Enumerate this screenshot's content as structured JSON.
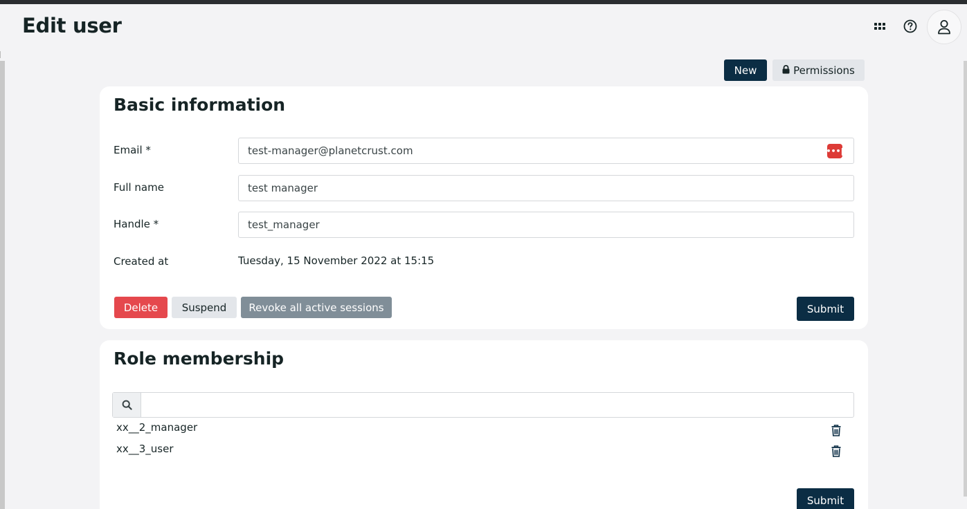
{
  "header": {
    "title": "Edit user",
    "icons": [
      "apps-grid-icon",
      "help-circle-icon",
      "user-avatar-icon"
    ]
  },
  "toolbar": {
    "new_label": "New",
    "permissions_label": "Permissions"
  },
  "basic_info": {
    "title": "Basic information",
    "fields": {
      "email": {
        "label": "Email *",
        "value": "test-manager@planetcrust.com"
      },
      "full_name": {
        "label": "Full name",
        "value": "test manager"
      },
      "handle": {
        "label": "Handle *",
        "value": "test_manager"
      },
      "created_at": {
        "label": "Created at",
        "value": "Tuesday, 15 November 2022 at 15:15"
      }
    },
    "password_manager_badge": "•••|",
    "buttons": {
      "delete": "Delete",
      "suspend": "Suspend",
      "revoke": "Revoke all active sessions",
      "submit": "Submit"
    }
  },
  "roles": {
    "title": "Role membership",
    "search": {
      "value": ""
    },
    "items": [
      {
        "name": "xx__2_manager"
      },
      {
        "name": "xx__3_user"
      }
    ],
    "submit": "Submit"
  },
  "colors": {
    "primary": "#0b2d44",
    "danger": "#e5484d",
    "muted_button": "#808e98",
    "light_button": "#e3e6ea",
    "background": "#f3f3f5",
    "password_badge": "#dd3b37"
  }
}
